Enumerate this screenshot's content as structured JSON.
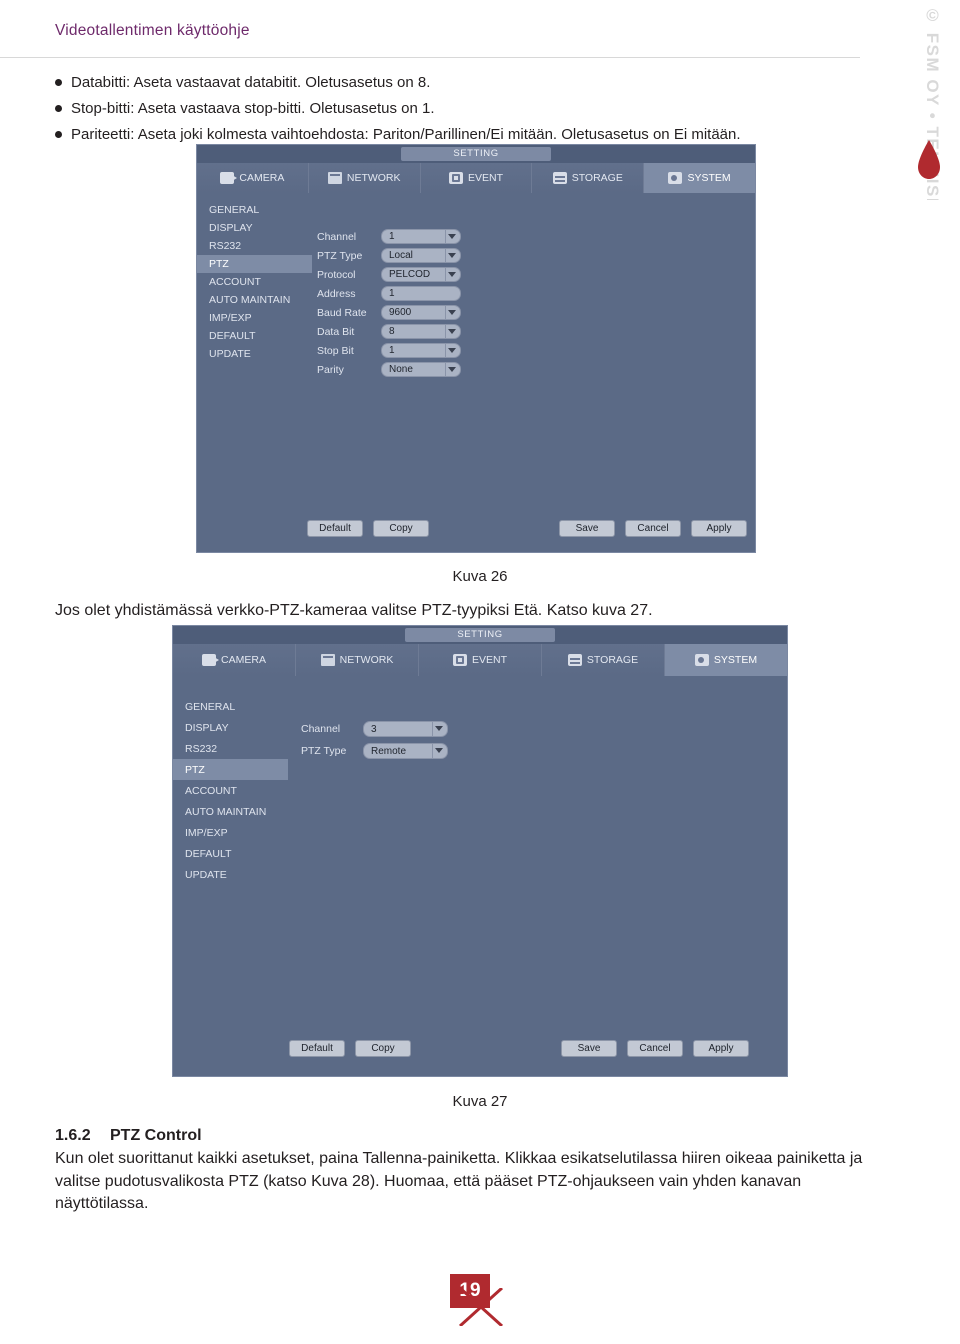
{
  "header": {
    "title": "Videotallentimen käyttöohje",
    "brand": "© FSM OY • TEKNISET OHJEET"
  },
  "bullets": [
    "Databitti: Aseta vastaavat databitit. Oletusasetus on 8.",
    "Stop-bitti: Aseta vastaava stop-bitti. Oletusasetus on 1.",
    "Pariteetti: Aseta joki kolmesta vaihtoehdosta: Pariton/Parillinen/Ei mitään. Oletusasetus on Ei mitään."
  ],
  "figure26": {
    "window_title": "SETTING",
    "tabs": [
      {
        "label": "CAMERA",
        "icon": "camera-icon",
        "active": false
      },
      {
        "label": "NETWORK",
        "icon": "network-icon",
        "active": false
      },
      {
        "label": "EVENT",
        "icon": "event-icon",
        "active": false
      },
      {
        "label": "STORAGE",
        "icon": "storage-icon",
        "active": false
      },
      {
        "label": "SYSTEM",
        "icon": "system-icon",
        "active": true
      }
    ],
    "sidebar": [
      {
        "label": "GENERAL",
        "active": false
      },
      {
        "label": "DISPLAY",
        "active": false
      },
      {
        "label": "RS232",
        "active": false
      },
      {
        "label": "PTZ",
        "active": true
      },
      {
        "label": "ACCOUNT",
        "active": false
      },
      {
        "label": "AUTO MAINTAIN",
        "active": false
      },
      {
        "label": "IMP/EXP",
        "active": false
      },
      {
        "label": "DEFAULT",
        "active": false
      },
      {
        "label": "UPDATE",
        "active": false
      }
    ],
    "fields": [
      {
        "label": "Channel",
        "value": "1",
        "type": "select"
      },
      {
        "label": "PTZ Type",
        "value": "Local",
        "type": "select"
      },
      {
        "label": "Protocol",
        "value": "PELCOD",
        "type": "select"
      },
      {
        "label": "Address",
        "value": "1",
        "type": "text"
      },
      {
        "label": "Baud Rate",
        "value": "9600",
        "type": "select"
      },
      {
        "label": "Data Bit",
        "value": "8",
        "type": "select"
      },
      {
        "label": "Stop Bit",
        "value": "1",
        "type": "select"
      },
      {
        "label": "Parity",
        "value": "None",
        "type": "select"
      }
    ],
    "buttons_left": [
      "Default",
      "Copy"
    ],
    "buttons_right": [
      "Save",
      "Cancel",
      "Apply"
    ],
    "caption": "Kuva 26"
  },
  "midline": "Jos olet yhdistämässä verkko-PTZ-kameraa valitse PTZ-tyypiksi Etä. Katso kuva 27.",
  "figure27": {
    "window_title": "SETTING",
    "tabs": [
      {
        "label": "CAMERA",
        "icon": "camera-icon",
        "active": false
      },
      {
        "label": "NETWORK",
        "icon": "network-icon",
        "active": false
      },
      {
        "label": "EVENT",
        "icon": "event-icon",
        "active": false
      },
      {
        "label": "STORAGE",
        "icon": "storage-icon",
        "active": false
      },
      {
        "label": "SYSTEM",
        "icon": "system-icon",
        "active": true
      }
    ],
    "sidebar": [
      {
        "label": "GENERAL",
        "active": false
      },
      {
        "label": "DISPLAY",
        "active": false
      },
      {
        "label": "RS232",
        "active": false
      },
      {
        "label": "PTZ",
        "active": true
      },
      {
        "label": "ACCOUNT",
        "active": false
      },
      {
        "label": "AUTO MAINTAIN",
        "active": false
      },
      {
        "label": "IMP/EXP",
        "active": false
      },
      {
        "label": "DEFAULT",
        "active": false
      },
      {
        "label": "UPDATE",
        "active": false
      }
    ],
    "fields": [
      {
        "label": "Channel",
        "value": "3",
        "type": "select"
      },
      {
        "label": "PTZ Type",
        "value": "Remote",
        "type": "select"
      }
    ],
    "buttons_left": [
      "Default",
      "Copy"
    ],
    "buttons_right": [
      "Save",
      "Cancel",
      "Apply"
    ],
    "caption": "Kuva 27"
  },
  "section": {
    "number": "1.6.2",
    "title": "PTZ Control",
    "paragraph": "Kun olet suorittanut kaikki asetukset, paina Tallenna-painiketta. Klikkaa esikatselutilassa hiiren oikeaa painiketta ja valitse pudotusvalikosta PTZ (katso Kuva 28). Huomaa, että pääset PTZ-ohjaukseen vain yhden kanavan näyttötilassa."
  },
  "footer": {
    "page_number": "19"
  },
  "colors": {
    "header_purple": "#6e2a6b",
    "dvr_bg": "#5b6a86",
    "dvr_active": "#7e8ca6",
    "footer_red": "#b02a2f"
  }
}
